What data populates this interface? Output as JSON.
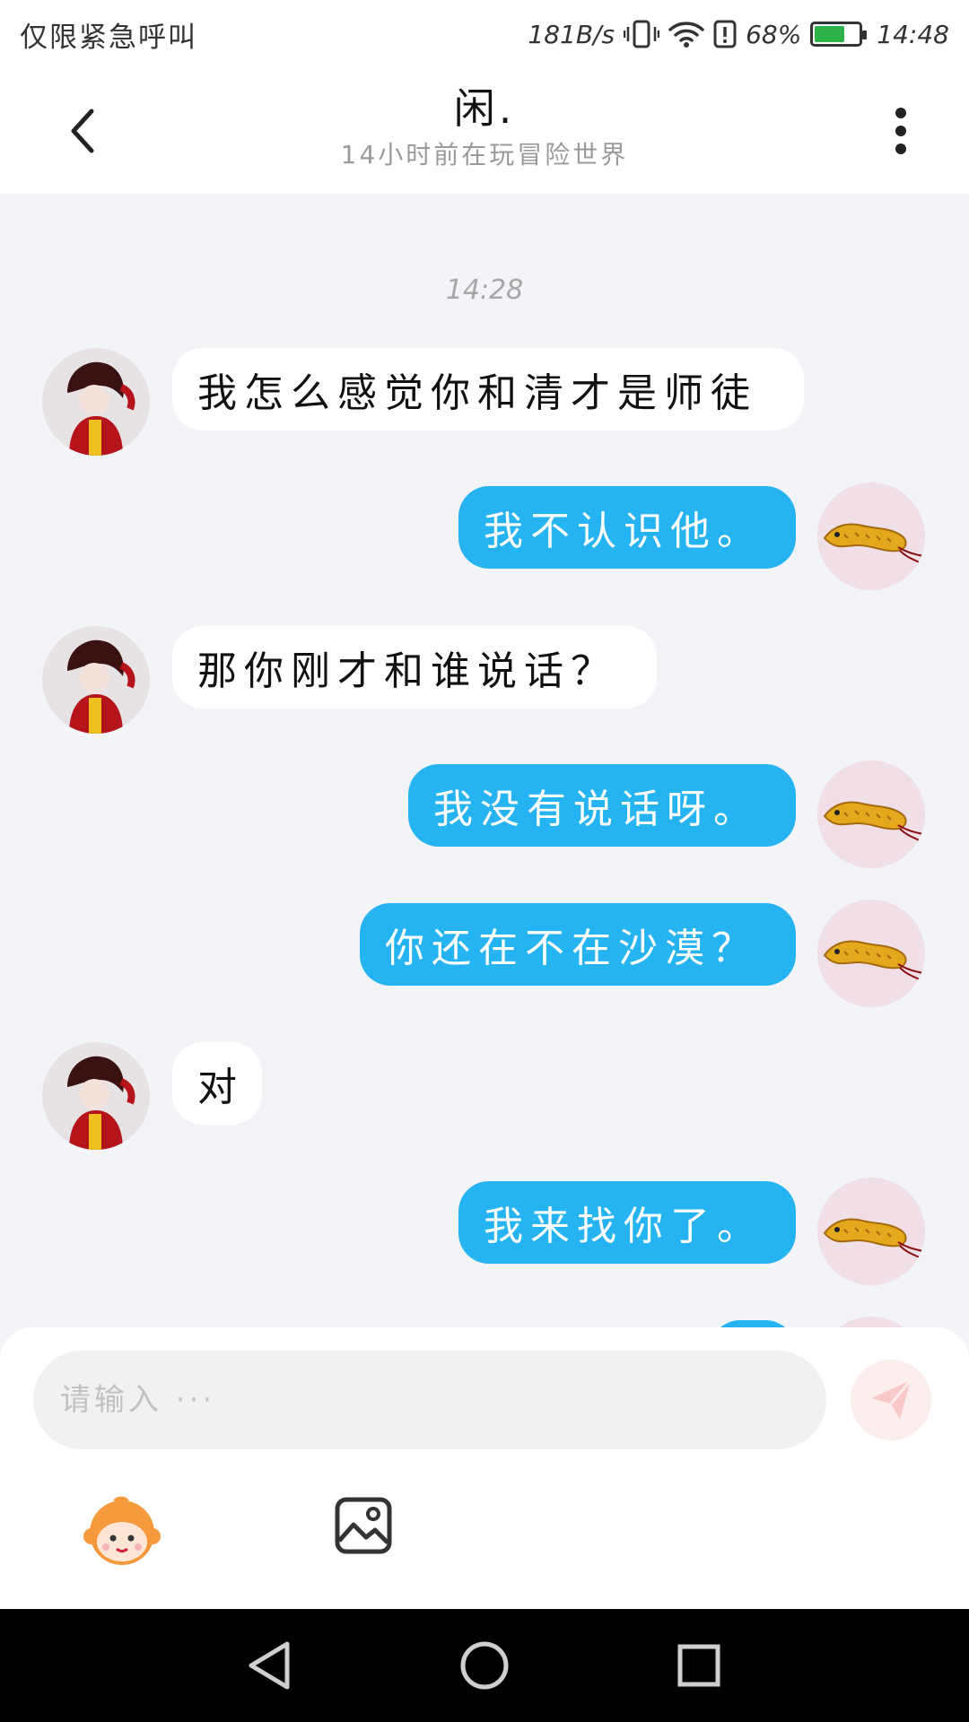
{
  "status_bar": {
    "carrier_text": "仅限紧急呼叫",
    "net_speed": "181B/s",
    "battery_percent": "68%",
    "battery_level": 0.68,
    "time": "14:48",
    "icons": [
      "vibrate-icon",
      "wifi-icon",
      "alert-icon",
      "battery-icon"
    ]
  },
  "header": {
    "title": "闲.",
    "subtitle": "14小时前在玩冒险世界",
    "back_icon": "chevron-left-icon",
    "more_icon": "more-vertical-icon"
  },
  "chat": {
    "timestamp": "14:28",
    "messages": [
      {
        "side": "in",
        "text": "我怎么感觉你和清才是师徒"
      },
      {
        "side": "out",
        "text": "我不认识他。"
      },
      {
        "side": "in",
        "text": "那你刚才和谁说话？"
      },
      {
        "side": "out",
        "text": "我没有说话呀。"
      },
      {
        "side": "out",
        "text": "你还在不在沙漠？"
      },
      {
        "side": "in",
        "text": "对"
      },
      {
        "side": "out",
        "text": "我来找你了。"
      }
    ],
    "colors": {
      "outgoing_bubble": "#26b3f2",
      "incoming_bubble": "#ffffff",
      "background": "#f2f4f7"
    }
  },
  "composer": {
    "placeholder": "请输入 ···",
    "value": "",
    "send_icon": "paper-plane-icon",
    "emoji_icon": "monkey-emoji-icon",
    "image_icon": "image-icon"
  },
  "nav_bar": {
    "buttons": [
      "back-triangle-icon",
      "home-circle-icon",
      "recents-square-icon"
    ]
  }
}
